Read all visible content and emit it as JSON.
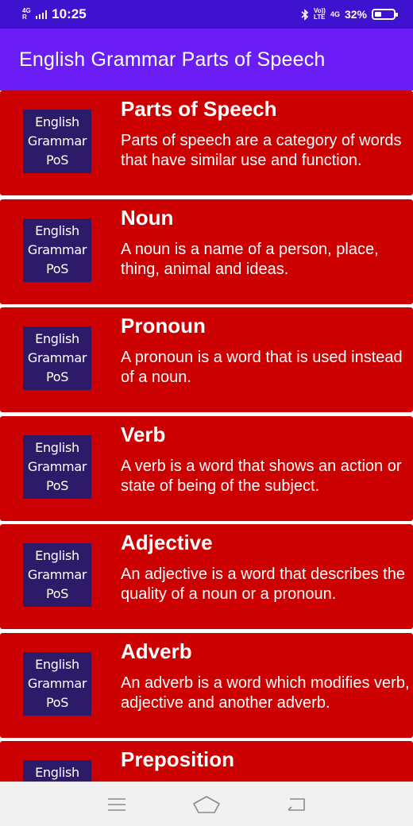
{
  "status_bar": {
    "network_top": "4G",
    "network_bottom": "R",
    "time": "10:25",
    "bluetooth_icon": "bluetooth-icon",
    "volte_top": "Vo))",
    "volte_bottom": "LTE",
    "data_label": "4G",
    "battery_percent": "32%",
    "battery_level": 0.32
  },
  "app_bar": {
    "title": "English Grammar Parts of Speech"
  },
  "thumbnail": {
    "line1": "English",
    "line2": "Grammar",
    "line3": "PoS"
  },
  "items": [
    {
      "title": "Parts of Speech",
      "description": "Parts of speech are a category of words that have similar use and function."
    },
    {
      "title": "Noun",
      "description": "A noun is a name of a person, place, thing, animal and ideas."
    },
    {
      "title": "Pronoun",
      "description": "A pronoun is a word that is used instead of a noun."
    },
    {
      "title": "Verb",
      "description": "A verb is a word that shows an action or state of being of the subject."
    },
    {
      "title": "Adjective",
      "description": "An adjective is a word that describes the quality of a noun or a pronoun."
    },
    {
      "title": "Adverb",
      "description": "An adverb is a word which modifies verb, adjective and another adverb."
    },
    {
      "title": "Preposition",
      "description": ""
    }
  ],
  "colors": {
    "status_bar": "#3f12d0",
    "app_bar": "#6a1ef5",
    "card": "#cc0000",
    "thumbnail": "#2d1b6a"
  },
  "nav_bar": {
    "menu_icon": "menu-icon",
    "home_icon": "home-icon",
    "back_icon": "back-icon"
  }
}
